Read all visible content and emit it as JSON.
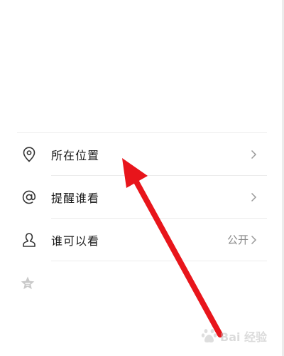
{
  "menu": {
    "items": [
      {
        "label": "所在位置",
        "icon": "location-pin-icon",
        "value": ""
      },
      {
        "label": "提醒谁看",
        "icon": "at-sign-icon",
        "value": ""
      },
      {
        "label": "谁可以看",
        "icon": "person-icon",
        "value": "公开"
      }
    ]
  },
  "colors": {
    "annotation_arrow": "#e8151b",
    "divider": "#ececec",
    "text": "#1a1a1a",
    "secondary_text": "#8a8a8a",
    "icon": "#333333"
  },
  "watermark": {
    "text": "Bai  经验"
  }
}
